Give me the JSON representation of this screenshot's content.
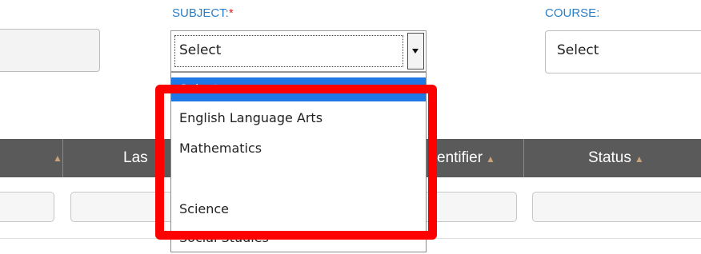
{
  "labels": {
    "subject": "SUBJECT:",
    "subject_required": "*",
    "course": "COURSE:"
  },
  "subject_select": {
    "value": "Select"
  },
  "course_select": {
    "value": "Select"
  },
  "table": {
    "headers": [
      "",
      "Las",
      "entifier",
      "Status"
    ]
  },
  "dropdown": {
    "options": [
      "Select",
      "English Language Arts",
      "Mathematics",
      "",
      "Science",
      "Social Studies"
    ],
    "selected_index": 0
  },
  "colors": {
    "accent": "#2a7fc9",
    "required": "#e02020",
    "highlight": "#ff0000",
    "header_bg": "#5a5a5a",
    "selected_option": "#1e78e6"
  }
}
